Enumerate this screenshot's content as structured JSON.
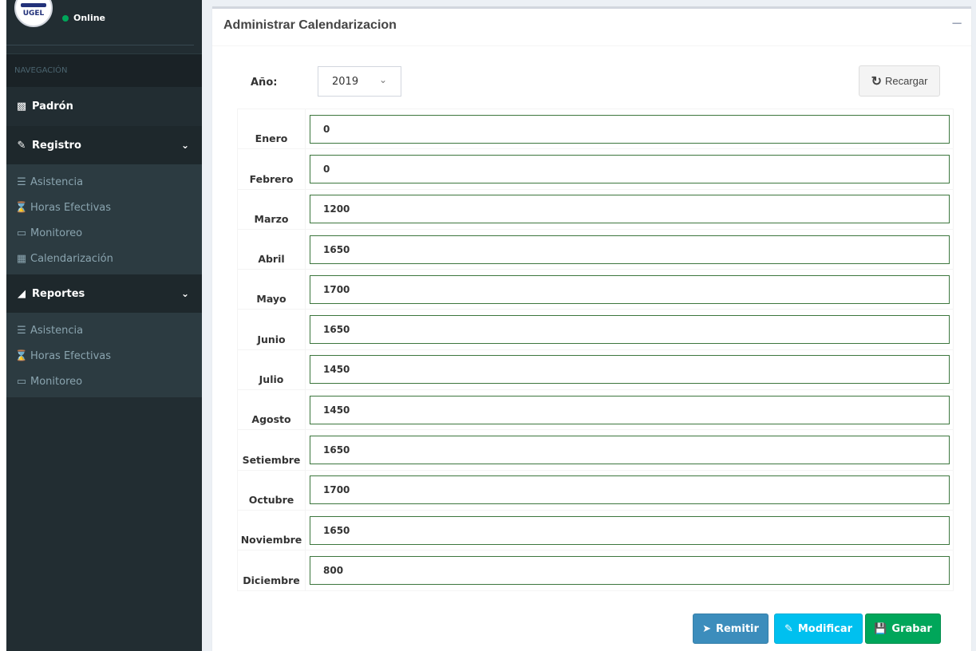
{
  "user": {
    "status": "Online",
    "logo_text": "UGEL"
  },
  "sidebar": {
    "header": "NAVEGACIÓN",
    "padron": {
      "icon": "book-icon",
      "label": "Padrón"
    },
    "registro": {
      "icon": "edit-icon",
      "label": "Registro",
      "items": [
        {
          "icon": "list-icon",
          "label": "Asistencia"
        },
        {
          "icon": "hourglass-icon",
          "label": "Horas Efectivas"
        },
        {
          "icon": "monitor-icon",
          "label": "Monitoreo"
        },
        {
          "icon": "calendar-icon",
          "label": "Calendarización"
        }
      ]
    },
    "reportes": {
      "icon": "area-chart-icon",
      "label": "Reportes",
      "items": [
        {
          "icon": "list-icon",
          "label": "Asistencia"
        },
        {
          "icon": "hourglass-icon",
          "label": "Horas Efectivas"
        },
        {
          "icon": "monitor-icon",
          "label": "Monitoreo"
        }
      ]
    }
  },
  "main": {
    "title": "Administrar Calendarizacion",
    "collapse": "−",
    "year_label": "Año:",
    "year_value": "2019",
    "reload_label": "Recargar",
    "months": [
      {
        "label": "Enero",
        "value": "0"
      },
      {
        "label": "Febrero",
        "value": "0"
      },
      {
        "label": "Marzo",
        "value": "1200"
      },
      {
        "label": "Abril",
        "value": "1650"
      },
      {
        "label": "Mayo",
        "value": "1700"
      },
      {
        "label": "Junio",
        "value": "1650"
      },
      {
        "label": "Julio",
        "value": "1450"
      },
      {
        "label": "Agosto",
        "value": "1450"
      },
      {
        "label": "Setiembre",
        "value": "1650"
      },
      {
        "label": "Octubre",
        "value": "1700"
      },
      {
        "label": "Noviembre",
        "value": "1650"
      },
      {
        "label": "Diciembre",
        "value": "800"
      }
    ],
    "buttons": {
      "send": "Remitir",
      "edit": "Modificar",
      "save": "Grabar"
    }
  },
  "colors": {
    "sidebar_bg": "#222d32",
    "submenu_bg": "#2c3b41",
    "primary": "#3c8dbc",
    "info": "#00c0ef",
    "success": "#00a65a",
    "input_border": "#3c763d"
  }
}
